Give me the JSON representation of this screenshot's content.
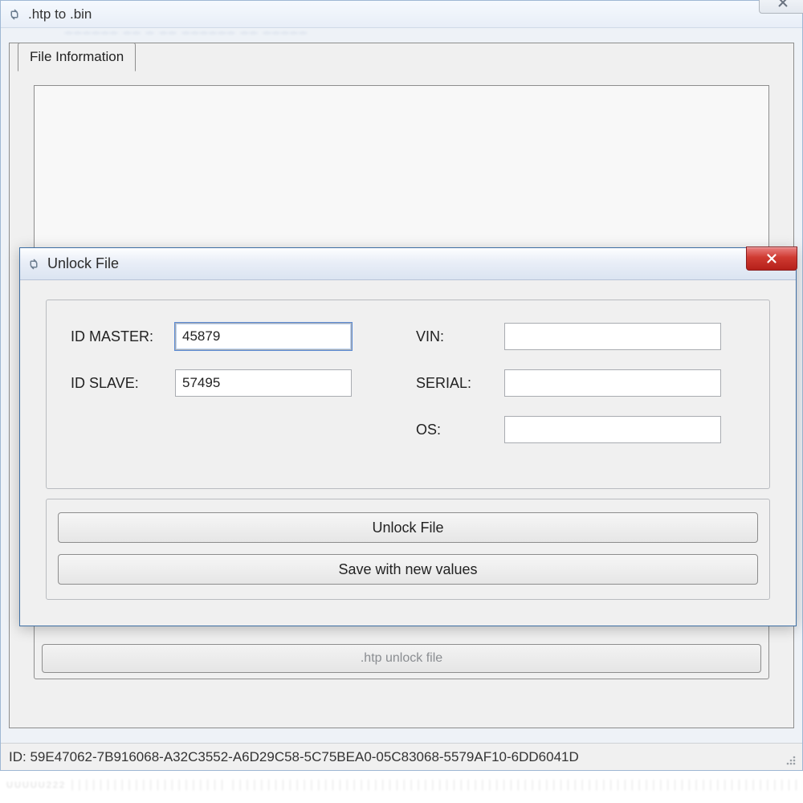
{
  "main_window": {
    "title": ".htp to .bin",
    "tab_label": "File Information",
    "bg_button_label": ".htp unlock file"
  },
  "statusbar": {
    "id_label": "ID:",
    "id_value": "59E47062-7B916068-A32C3552-A6D29C58-5C75BEA0-05C83068-5579AF10-6DD6041D"
  },
  "dialog": {
    "title": "Unlock File",
    "labels": {
      "id_master": "ID MASTER:",
      "id_slave": "ID SLAVE:",
      "vin": "VIN:",
      "serial": "SERIAL:",
      "os": "OS:"
    },
    "values": {
      "id_master": "45879",
      "id_slave": "57495",
      "vin": "",
      "serial": "",
      "os": ""
    },
    "buttons": {
      "unlock": "Unlock File",
      "save": "Save with new values"
    }
  }
}
